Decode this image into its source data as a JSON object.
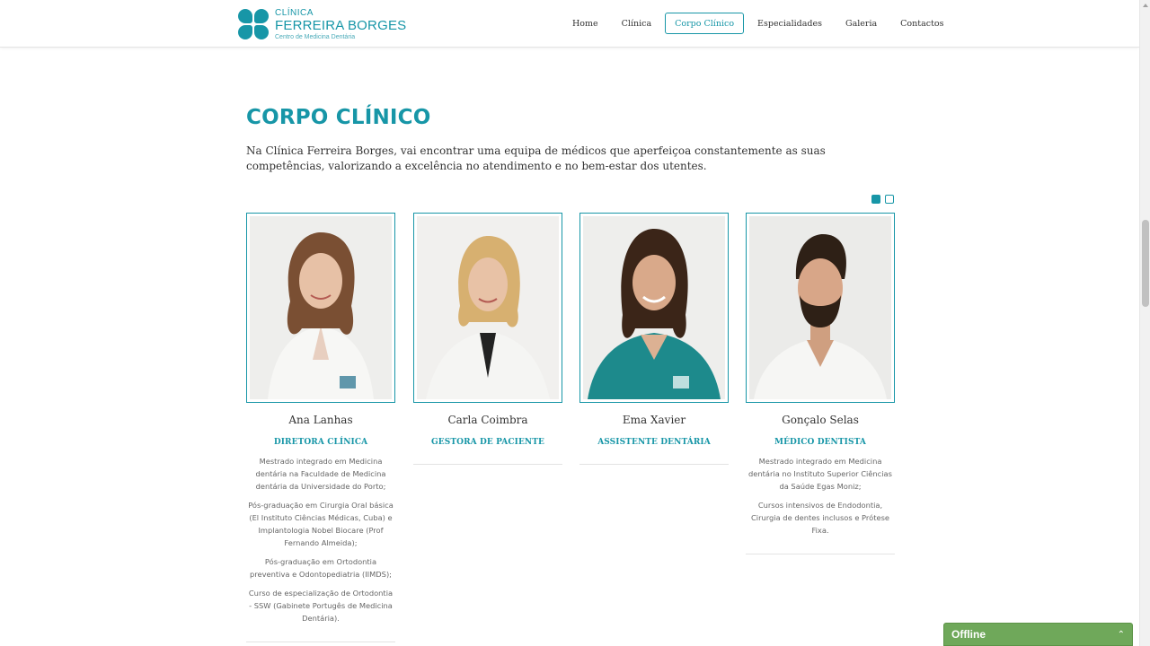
{
  "brand": {
    "small": "CLÍNICA",
    "big": "FERREIRA BORGES",
    "sub": "Centro de Medicina Dentária",
    "accent": "#1796a7"
  },
  "nav": {
    "items": [
      {
        "label": "Home"
      },
      {
        "label": "Clínica"
      },
      {
        "label": "Corpo Clínico",
        "active": true
      },
      {
        "label": "Especialidades"
      },
      {
        "label": "Galeria"
      },
      {
        "label": "Contactos"
      }
    ]
  },
  "section": {
    "title": "CORPO CLÍNICO",
    "intro": "Na Clínica Ferreira Borges, vai encontrar uma equipa de médicos que aperfeiçoa constantemente as suas competências, valorizando a excelência no atendimento e no bem-estar dos utentes."
  },
  "carousel": {
    "pages": 2,
    "active": 1
  },
  "team": [
    {
      "name": "Ana Lanhas",
      "role": "DIRETORA CLÍNICA",
      "desc": [
        "Mestrado integrado em Medicina dentária na Faculdade de Medicina dentária da Universidade do Porto;",
        "Pós-graduação em Cirurgia Oral básica (El Instituto Ciências Médicas, Cuba) e Implantologia Nobel Biocare (Prof Fernando Almeida);",
        "Pós-graduação em Ortodontia preventiva e Odontopediatria (IIMDS);",
        "Curso de especialização de Ortodontia - SSW (Gabinete Portugês de Medicina Dentária)."
      ]
    },
    {
      "name": "Carla Coimbra",
      "role": "GESTORA DE PACIENTE",
      "desc": []
    },
    {
      "name": "Ema Xavier",
      "role": "ASSISTENTE DENTÁRIA",
      "desc": []
    },
    {
      "name": "Gonçalo Selas",
      "role": "MÉDICO DENTISTA",
      "desc": [
        "Mestrado integrado em Medicina dentária no Instituto Superior Ciências da Saúde Egas Moniz;",
        "Cursos intensivos de Endodontia, Cirurgia de dentes inclusos e Prótese Fixa."
      ]
    }
  ],
  "chat": {
    "label": "Offline",
    "icon": "chevron-up-icon",
    "color": "#6fa85a"
  }
}
